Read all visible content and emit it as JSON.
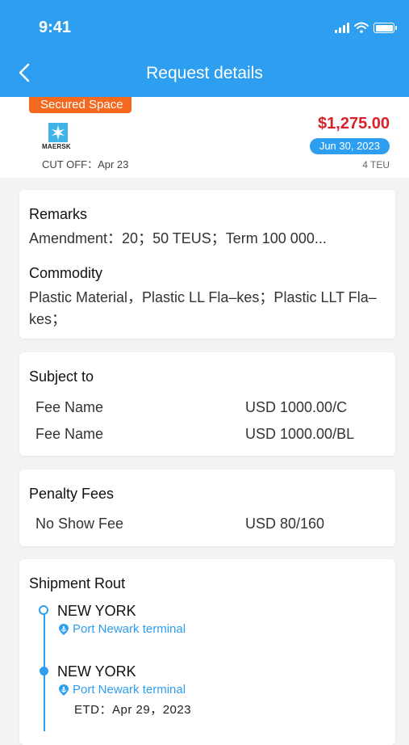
{
  "status_bar": {
    "time": "9:41"
  },
  "nav": {
    "title": "Request details"
  },
  "summary": {
    "tag": "Secured Space",
    "carrier_logo_text": "MAERSK",
    "cutoff": "CUT OFF：Apr 23",
    "price": "$1,275.00",
    "date": "Jun 30, 2023",
    "teu": "4 TEU"
  },
  "remarks": {
    "title": "Remarks",
    "text": "Amendment：20；50 TEUS；Term 100 000...",
    "commodity_title": "Commodity",
    "commodity_text": "Plastic Material，Plastic LL Fla–kes；Plastic LLT Fla–kes；"
  },
  "subject_to": {
    "title": "Subject to",
    "rows": [
      {
        "name": "Fee Name",
        "value": "USD 1000.00/C"
      },
      {
        "name": "Fee Name",
        "value": "USD 1000.00/BL"
      }
    ]
  },
  "penalty": {
    "title": "Penalty Fees",
    "rows": [
      {
        "name": "No Show Fee",
        "value": "USD 80/160"
      }
    ]
  },
  "route": {
    "title": "Shipment Rout",
    "stops": [
      {
        "city": "NEW YORK",
        "port": "Port Newark terminal"
      },
      {
        "city": "NEW YORK",
        "port": "Port Newark terminal",
        "etd": "ETD：Apr 29，2023"
      }
    ]
  },
  "colors": {
    "accent": "#2e9ff0",
    "tag": "#f4691d",
    "price": "#d8222b"
  }
}
